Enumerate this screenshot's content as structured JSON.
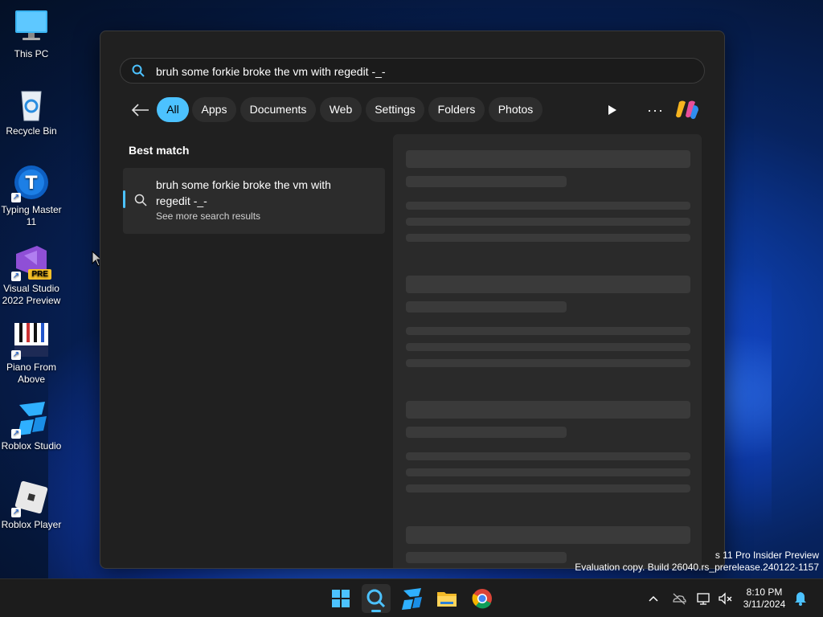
{
  "desktop": {
    "icons": [
      {
        "label": "This PC",
        "icon": "computer-icon"
      },
      {
        "label": "Recycle Bin",
        "icon": "recycle-bin-icon"
      },
      {
        "label": "Typing Master 11",
        "icon": "typing-master-icon"
      },
      {
        "label": "Visual Studio 2022 Preview",
        "icon": "visual-studio-icon",
        "badge": "PRE"
      },
      {
        "label": "Piano From Above",
        "icon": "piano-icon"
      },
      {
        "label": "Roblox Studio",
        "icon": "roblox-studio-icon"
      },
      {
        "label": "Roblox Player",
        "icon": "roblox-player-icon"
      }
    ]
  },
  "search": {
    "query": "bruh some forkie broke the vm with regedit -_-",
    "filters": [
      "All",
      "Apps",
      "Documents",
      "Web",
      "Settings",
      "Folders",
      "Photos"
    ],
    "active_filter": "All",
    "best_match_label": "Best match",
    "result": {
      "title": "bruh some forkie broke the vm with regedit -_-",
      "subtitle": "See more search results"
    },
    "accent_color": "#4cc2ff"
  },
  "watermark": {
    "line1": "s 11 Pro Insider Preview",
    "line2": "Evaluation copy. Build 26040.rs_prerelease.240122-1157"
  },
  "taskbar": {
    "apps": [
      "start-icon",
      "search-icon",
      "roblox-studio-icon",
      "file-explorer-icon",
      "chrome-icon"
    ],
    "time": "8:10 PM",
    "date": "3/11/2024"
  }
}
